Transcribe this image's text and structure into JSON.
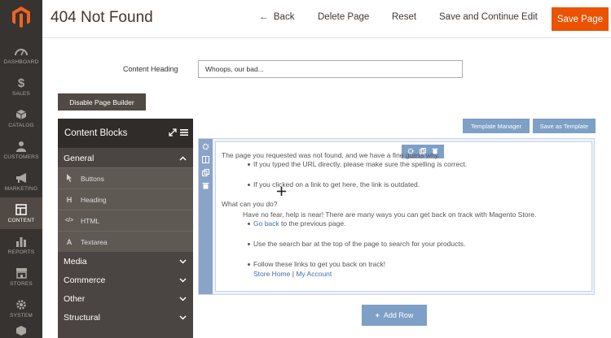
{
  "nav": {
    "items": [
      {
        "label": "DASHBOARD",
        "icon": "dashboard-icon"
      },
      {
        "label": "SALES",
        "icon": "dollar-icon"
      },
      {
        "label": "CATALOG",
        "icon": "box-icon"
      },
      {
        "label": "CUSTOMERS",
        "icon": "user-icon"
      },
      {
        "label": "MARKETING",
        "icon": "megaphone-icon"
      },
      {
        "label": "CONTENT",
        "icon": "layout-icon"
      },
      {
        "label": "REPORTS",
        "icon": "bar-chart-icon"
      },
      {
        "label": "STORES",
        "icon": "store-icon"
      },
      {
        "label": "SYSTEM",
        "icon": "gear-icon"
      }
    ],
    "active_item": "CONTENT"
  },
  "header": {
    "title": "404 Not Found",
    "back": "Back",
    "delete": "Delete Page",
    "reset": "Reset",
    "save_continue": "Save and Continue Edit",
    "save_page": "Save Page"
  },
  "content_heading": {
    "label": "Content Heading",
    "value": "Whoops, our bad..."
  },
  "disable_page_builder": "Disable Page Builder",
  "blocks_panel": {
    "title": "Content Blocks",
    "groups": [
      "General",
      "Media",
      "Commerce",
      "Other",
      "Structural"
    ],
    "general_items": [
      {
        "label": "Buttons",
        "icon": "cursor-icon"
      },
      {
        "label": "Heading",
        "icon": "heading-icon"
      },
      {
        "label": "HTML",
        "icon": "code-icon"
      },
      {
        "label": "Textarea",
        "icon": "text-icon"
      }
    ]
  },
  "template": {
    "manager": "Template Manager",
    "save_as": "Save as Template"
  },
  "stage": {
    "intro": "The page you requested was not found, and we have a fine guess why.",
    "bullets_1": [
      "If you typed the URL directly, please make sure the spelling is correct.",
      "If you clicked on a link to get here, the link is outdated."
    ],
    "question": "What can you do?",
    "help": "Have no fear, help is near! There are many ways you can get back on track with Magento Store.",
    "go_back_link": "Go back",
    "go_back_rest": "to the previous page.",
    "search_hint": "Use the search bar at the top of the page to search for your products.",
    "follow": "Follow these links to get you back on track!",
    "store_home": "Store Home",
    "separator": "|",
    "my_account": "My Account"
  },
  "add_row": "Add Row",
  "colors": {
    "accent": "#eb5202",
    "nav_bg": "#373330",
    "stage_blue": "#7e9fc6",
    "link": "#3e6fb5"
  }
}
